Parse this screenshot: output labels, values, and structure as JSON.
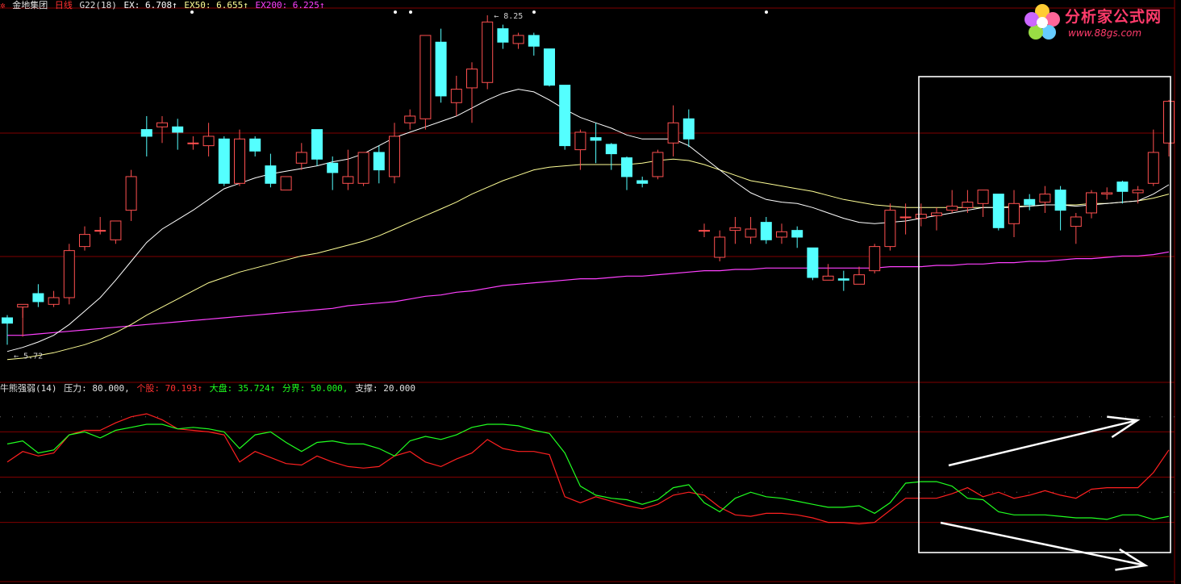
{
  "header": {
    "stock": "金地集团",
    "period": "日线",
    "indicator": "G22(18)",
    "ex": "EX: 6.708↑",
    "ex50": "EX50: 6.655↑",
    "ex200": "EX200: 6.225↑"
  },
  "sub_header": {
    "name": "牛熊强弱(14)",
    "pressure": "压力: 80.000,",
    "stock_line": "个股: 70.193↑",
    "market_line": "大盘: 35.724↑",
    "divider": "分界: 50.000,",
    "support": "支撑: 20.000"
  },
  "logo": {
    "brand": "分析家公式网",
    "url": "www.88gs.com"
  },
  "colors": {
    "up": "#ff5050",
    "down": "#54ffff",
    "ma_short": "#ffffff",
    "ma_mid": "#ffff96",
    "ma_long": "#ff40ff",
    "stock_line": "#ff2020",
    "market_line": "#20ff20",
    "grid": "#800000"
  },
  "chart_data": [
    {
      "type": "candlestick",
      "annotations": [
        {
          "text": "8.25",
          "x": 31,
          "y": 8.25
        },
        {
          "text": "5.72",
          "x": 0,
          "y": 5.72
        }
      ],
      "candles": [
        [
          6.0,
          5.96,
          5.8,
          6.02
        ],
        [
          6.08,
          6.1,
          5.86,
          6.0
        ],
        [
          6.18,
          6.12,
          6.08,
          6.25
        ],
        [
          6.1,
          6.15,
          6.08,
          6.2
        ],
        [
          6.15,
          6.5,
          6.1,
          6.55
        ],
        [
          6.53,
          6.62,
          6.5,
          6.68
        ],
        [
          6.65,
          6.65,
          6.62,
          6.75
        ],
        [
          6.58,
          6.72,
          6.55,
          6.72
        ],
        [
          6.8,
          7.05,
          6.72,
          7.1
        ],
        [
          7.4,
          7.35,
          7.2,
          7.5
        ],
        [
          7.42,
          7.45,
          7.3,
          7.5
        ],
        [
          7.42,
          7.38,
          7.25,
          7.48
        ],
        [
          7.3,
          7.3,
          7.25,
          7.35
        ],
        [
          7.28,
          7.35,
          7.2,
          7.45
        ],
        [
          7.33,
          7.0,
          6.98,
          7.35
        ],
        [
          7.0,
          7.33,
          6.98,
          7.4
        ],
        [
          7.33,
          7.24,
          7.2,
          7.35
        ],
        [
          7.13,
          7.0,
          6.97,
          7.22
        ],
        [
          6.95,
          7.05,
          6.95,
          7.05
        ],
        [
          7.15,
          7.23,
          7.1,
          7.3
        ],
        [
          7.4,
          7.18,
          7.13,
          7.4
        ],
        [
          7.15,
          7.08,
          6.95,
          7.2
        ],
        [
          7.0,
          7.05,
          6.95,
          7.25
        ],
        [
          7.0,
          7.23,
          6.98,
          7.23
        ],
        [
          7.23,
          7.1,
          7.0,
          7.28
        ],
        [
          7.05,
          7.35,
          7.0,
          7.45
        ],
        [
          7.45,
          7.5,
          7.4,
          7.55
        ],
        [
          7.48,
          8.1,
          7.4,
          8.1
        ],
        [
          8.05,
          7.65,
          7.6,
          8.15
        ],
        [
          7.6,
          7.7,
          7.5,
          7.8
        ],
        [
          7.71,
          7.85,
          7.45,
          7.9
        ],
        [
          7.75,
          8.2,
          7.7,
          8.25
        ],
        [
          8.15,
          8.05,
          8.0,
          8.18
        ],
        [
          8.04,
          8.1,
          8.0,
          8.12
        ],
        [
          8.1,
          8.02,
          7.95,
          8.12
        ],
        [
          8.0,
          7.73,
          7.72,
          8.0
        ],
        [
          7.73,
          7.28,
          7.25,
          7.73
        ],
        [
          7.25,
          7.38,
          7.1,
          7.4
        ],
        [
          7.34,
          7.32,
          7.15,
          7.45
        ],
        [
          7.29,
          7.22,
          7.1,
          7.3
        ],
        [
          7.19,
          7.05,
          6.95,
          7.2
        ],
        [
          7.02,
          7.0,
          6.97,
          7.05
        ],
        [
          7.05,
          7.23,
          7.03,
          7.25
        ],
        [
          7.3,
          7.45,
          7.2,
          7.58
        ],
        [
          7.48,
          7.33,
          7.27,
          7.55
        ],
        [
          6.65,
          6.65,
          6.6,
          6.7
        ],
        [
          6.45,
          6.6,
          6.42,
          6.65
        ],
        [
          6.65,
          6.67,
          6.55,
          6.75
        ],
        [
          6.6,
          6.66,
          6.55,
          6.75
        ],
        [
          6.71,
          6.58,
          6.55,
          6.75
        ],
        [
          6.6,
          6.64,
          6.55,
          6.7
        ],
        [
          6.65,
          6.6,
          6.52,
          6.68
        ],
        [
          6.52,
          6.3,
          6.28,
          6.52
        ],
        [
          6.28,
          6.31,
          6.28,
          6.4
        ],
        [
          6.29,
          6.28,
          6.2,
          6.35
        ],
        [
          6.25,
          6.32,
          6.25,
          6.38
        ],
        [
          6.35,
          6.53,
          6.33,
          6.55
        ],
        [
          6.53,
          6.8,
          6.5,
          6.85
        ],
        [
          6.75,
          6.75,
          6.62,
          6.85
        ],
        [
          6.74,
          6.77,
          6.68,
          6.85
        ],
        [
          6.76,
          6.78,
          6.65,
          6.82
        ],
        [
          6.8,
          6.83,
          6.78,
          6.95
        ],
        [
          6.82,
          6.86,
          6.78,
          6.95
        ],
        [
          6.85,
          6.95,
          6.75,
          6.95
        ],
        [
          6.92,
          6.67,
          6.65,
          6.92
        ],
        [
          6.7,
          6.85,
          6.6,
          6.95
        ],
        [
          6.88,
          6.84,
          6.8,
          6.92
        ],
        [
          6.86,
          6.92,
          6.78,
          6.98
        ],
        [
          6.95,
          6.8,
          6.65,
          6.98
        ],
        [
          6.68,
          6.75,
          6.55,
          6.78
        ],
        [
          6.78,
          6.93,
          6.74,
          6.95
        ],
        [
          6.92,
          6.93,
          6.88,
          6.97
        ],
        [
          7.01,
          6.94,
          6.85,
          7.02
        ],
        [
          6.93,
          6.95,
          6.85,
          6.98
        ],
        [
          7.0,
          7.23,
          6.98,
          7.4
        ],
        [
          7.3,
          7.61,
          7.2,
          7.62
        ]
      ],
      "ma_short": [
        5.75,
        5.78,
        5.82,
        5.87,
        5.95,
        6.05,
        6.15,
        6.28,
        6.42,
        6.56,
        6.66,
        6.73,
        6.8,
        6.88,
        6.96,
        7.0,
        7.04,
        7.07,
        7.09,
        7.11,
        7.13,
        7.16,
        7.18,
        7.22,
        7.28,
        7.34,
        7.38,
        7.42,
        7.46,
        7.5,
        7.56,
        7.62,
        7.67,
        7.7,
        7.68,
        7.62,
        7.55,
        7.49,
        7.45,
        7.41,
        7.36,
        7.33,
        7.33,
        7.33,
        7.28,
        7.19,
        7.1,
        7.01,
        6.93,
        6.88,
        6.86,
        6.85,
        6.82,
        6.78,
        6.74,
        6.71,
        6.7,
        6.71,
        6.72,
        6.74,
        6.76,
        6.78,
        6.8,
        6.82,
        6.82,
        6.82,
        6.83,
        6.84,
        6.84,
        6.83,
        6.84,
        6.85,
        6.86,
        6.87,
        6.92,
        6.99
      ],
      "ma_mid": [
        5.69,
        5.7,
        5.72,
        5.74,
        5.77,
        5.8,
        5.84,
        5.89,
        5.95,
        6.02,
        6.08,
        6.14,
        6.2,
        6.26,
        6.3,
        6.34,
        6.37,
        6.4,
        6.43,
        6.46,
        6.48,
        6.51,
        6.54,
        6.57,
        6.61,
        6.66,
        6.71,
        6.76,
        6.81,
        6.86,
        6.92,
        6.97,
        7.02,
        7.06,
        7.1,
        7.12,
        7.13,
        7.14,
        7.14,
        7.14,
        7.14,
        7.15,
        7.17,
        7.18,
        7.17,
        7.14,
        7.1,
        7.06,
        7.02,
        7.0,
        6.98,
        6.96,
        6.94,
        6.91,
        6.88,
        6.86,
        6.84,
        6.83,
        6.82,
        6.82,
        6.82,
        6.82,
        6.82,
        6.82,
        6.82,
        6.83,
        6.83,
        6.84,
        6.84,
        6.84,
        6.85,
        6.85,
        6.86,
        6.87,
        6.89,
        6.92
      ],
      "ma_long": [
        5.87,
        5.87,
        5.88,
        5.89,
        5.9,
        5.91,
        5.92,
        5.93,
        5.94,
        5.95,
        5.96,
        5.97,
        5.98,
        5.99,
        6.0,
        6.01,
        6.02,
        6.03,
        6.04,
        6.05,
        6.06,
        6.07,
        6.09,
        6.1,
        6.11,
        6.12,
        6.14,
        6.16,
        6.17,
        6.19,
        6.2,
        6.22,
        6.24,
        6.25,
        6.26,
        6.27,
        6.28,
        6.29,
        6.29,
        6.3,
        6.31,
        6.31,
        6.32,
        6.33,
        6.34,
        6.35,
        6.35,
        6.36,
        6.36,
        6.37,
        6.37,
        6.37,
        6.37,
        6.37,
        6.37,
        6.37,
        6.37,
        6.38,
        6.38,
        6.38,
        6.39,
        6.39,
        6.4,
        6.4,
        6.41,
        6.41,
        6.42,
        6.42,
        6.43,
        6.44,
        6.44,
        6.45,
        6.46,
        6.46,
        6.47,
        6.49
      ]
    },
    {
      "type": "line",
      "ylim": [
        0,
        100
      ],
      "reference_lines": [
        80,
        50,
        20
      ],
      "series": [
        {
          "name": "个股",
          "values": [
            60,
            67,
            64,
            66,
            78,
            81,
            81,
            86,
            90,
            92,
            88,
            82,
            81,
            80,
            78,
            60,
            67,
            63,
            59,
            58,
            64,
            60,
            57,
            56,
            57,
            64,
            67,
            60,
            57,
            62,
            66,
            75,
            69,
            67,
            67,
            65,
            37,
            33,
            37,
            34,
            31,
            29,
            32,
            38,
            40,
            38,
            30,
            25,
            24,
            26,
            26,
            25,
            23,
            20,
            20,
            19,
            20,
            28,
            36,
            36,
            36,
            39,
            43,
            37,
            40,
            36,
            38,
            41,
            38,
            36,
            42,
            43,
            43,
            43,
            53,
            68
          ]
        },
        {
          "name": "大盘",
          "values": [
            72,
            74,
            66,
            68,
            78,
            80,
            76,
            81,
            83,
            85,
            85,
            82,
            83,
            82,
            80,
            69,
            78,
            80,
            73,
            67,
            73,
            74,
            72,
            72,
            69,
            64,
            74,
            77,
            75,
            78,
            83,
            85,
            85,
            84,
            81,
            79,
            66,
            44,
            38,
            36,
            35,
            32,
            35,
            43,
            45,
            33,
            27,
            36,
            40,
            37,
            36,
            34,
            32,
            30,
            30,
            31,
            26,
            33,
            46,
            47,
            47,
            44,
            36,
            35,
            27,
            25,
            25,
            25,
            24,
            23,
            23,
            22,
            25,
            25,
            22,
            24
          ]
        }
      ]
    }
  ]
}
